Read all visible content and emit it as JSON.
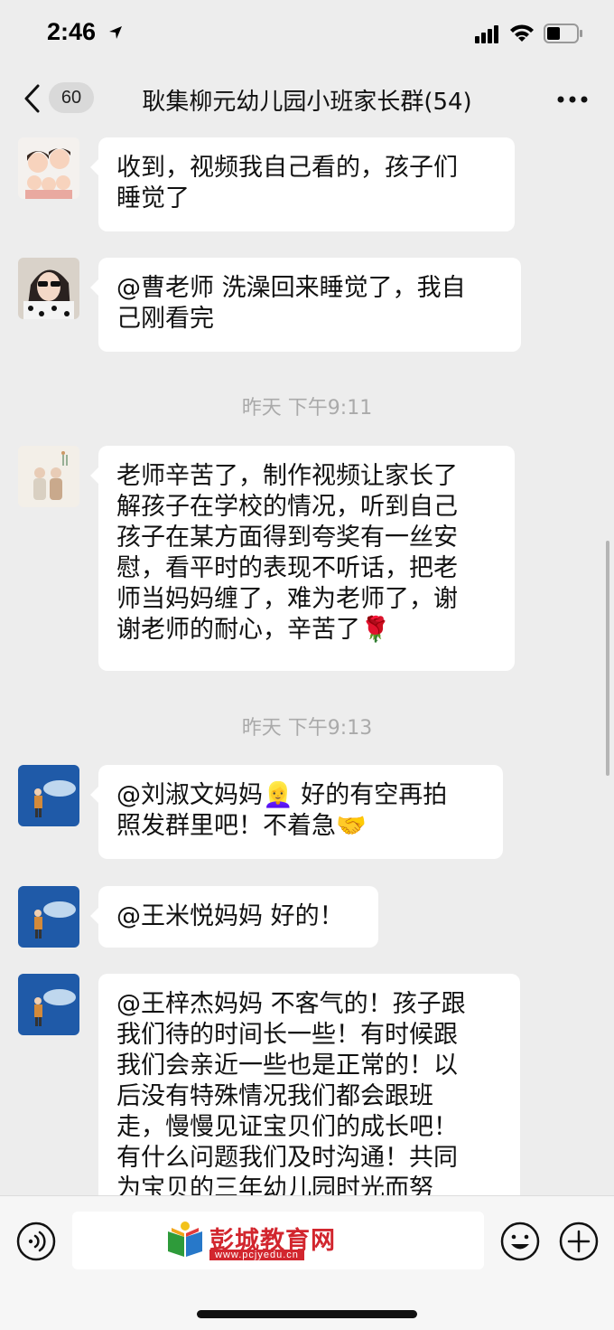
{
  "status_bar": {
    "time": "2:46"
  },
  "nav": {
    "unread_count": "60",
    "title": "耿集柳元幼儿园小班家长群(54)"
  },
  "messages": [
    {
      "text": "收到，视频我自己看的，孩子们\n睡觉了",
      "avatar": "family-cartoon-avatar"
    },
    {
      "text": "@曹老师 洗澡回来睡觉了，我自\n己刚看完",
      "avatar": "woman-sunglasses-avatar"
    },
    {
      "text": "老师辛苦了，制作视频让家长了\n解孩子在学校的情况，听到自己\n孩子在某方面得到夸奖有一丝安\n慰，看平时的表现不听话，把老\n师当妈妈缠了，难为老师了，谢\n谢老师的耐心，辛苦了🌹",
      "avatar": "elderly-couple-avatar"
    },
    {
      "text": "@刘淑文妈妈👱‍♀️ 好的有空再拍\n照发群里吧！不着急🤝",
      "avatar": "child-aquarium-avatar"
    },
    {
      "text": "@王米悦妈妈 好的！",
      "avatar": "child-aquarium-avatar"
    },
    {
      "text": "@王梓杰妈妈 不客气的！孩子跟\n我们待的时间长一些！有时候跟\n我们会亲近一些也是正常的！以\n后没有特殊情况我们都会跟班\n走，慢慢见证宝贝们的成长吧！\n有什么问题我们及时沟通！共同\n为宝贝的三年幼儿园时光而努",
      "avatar": "child-aquarium-avatar"
    }
  ],
  "timestamps": [
    "昨天 下午9:11",
    "昨天 下午9:13"
  ],
  "input_bar": {
    "logo_text": "彭城教育网",
    "logo_url": "www.pcjyedu.cn"
  },
  "colors": {
    "background": "#ededed",
    "bubble": "#ffffff",
    "logo_red": "#d2262e"
  }
}
